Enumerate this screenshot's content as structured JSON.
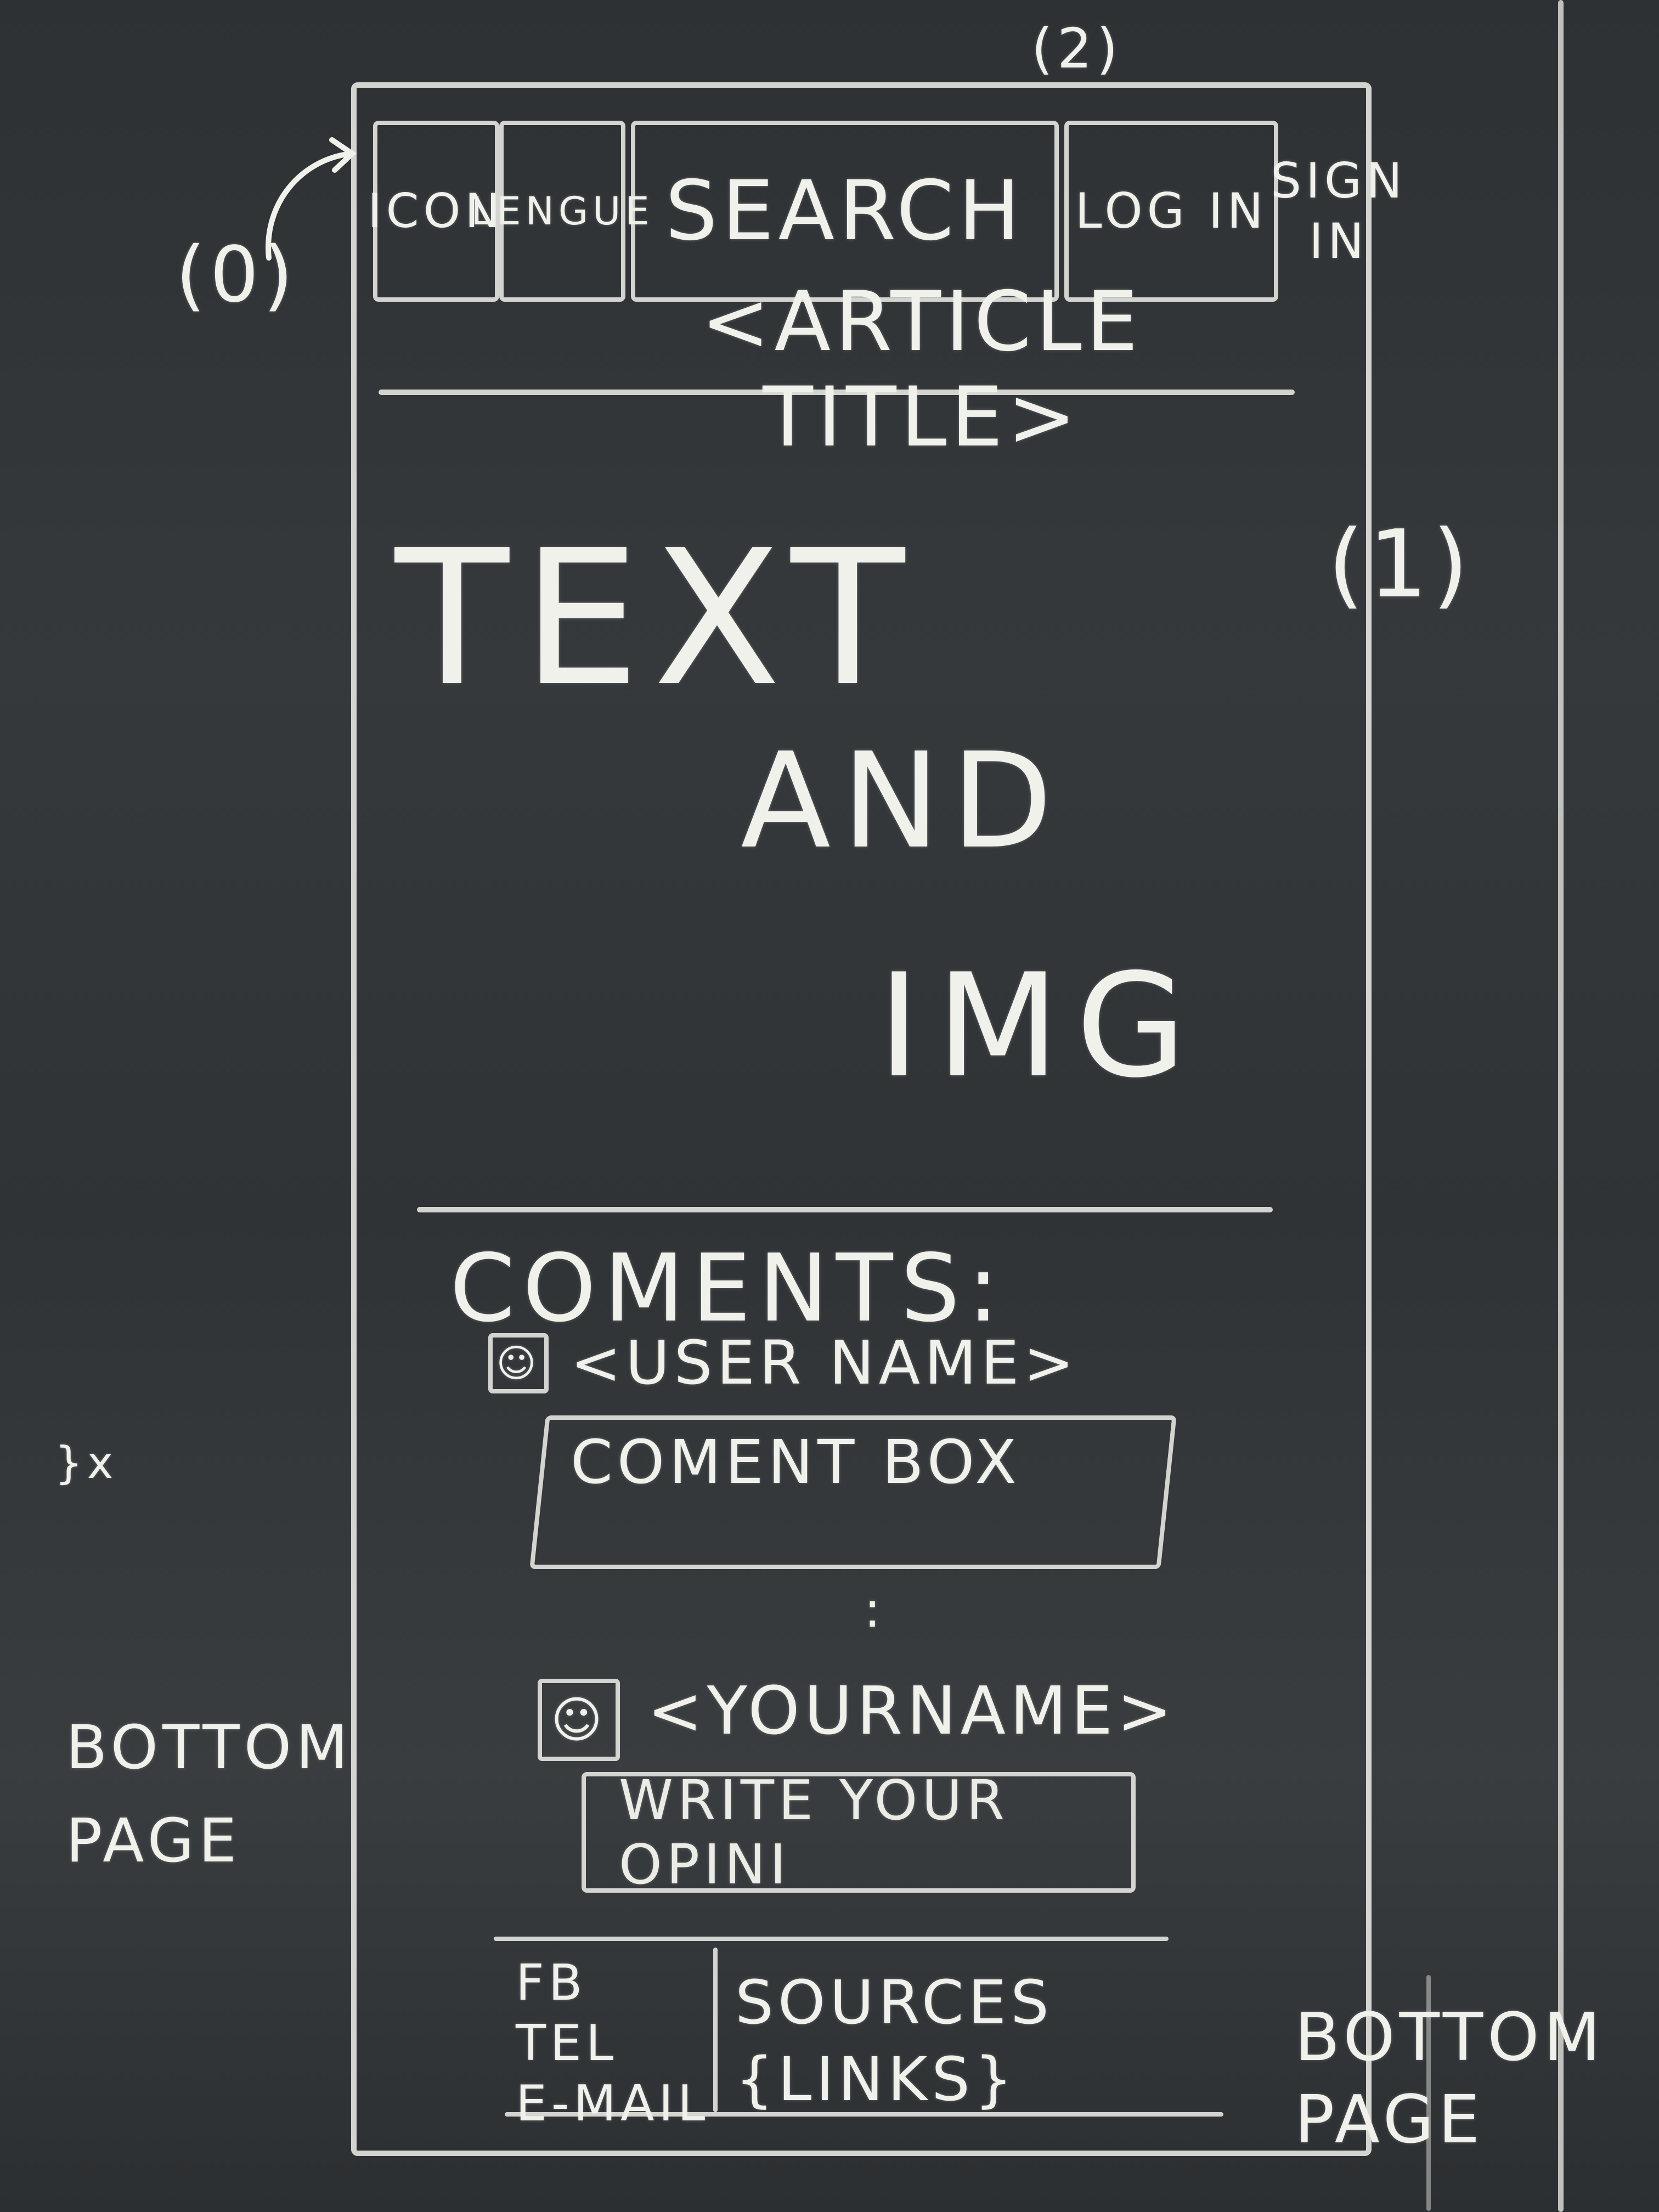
{
  "header": {
    "icon_label": "ICON",
    "language_label": "LENGUE",
    "search_label": "SEARCH",
    "login_label": "LOG IN",
    "signin_label": "SIGN IN"
  },
  "annotations": {
    "label_0": "(0)",
    "label_1": "(1)",
    "label_2": "(2)",
    "left_x": "}x",
    "left_bottom_page": "BOTTOM PAGE",
    "right_bottom_page": "BOTTOM PAGE"
  },
  "article": {
    "title": "<ARTICLE TITLE>",
    "content_text": "TEXT",
    "content_and": "AND",
    "content_img": "IMG"
  },
  "comments": {
    "heading": "COMENTS:",
    "user_name": "<USER NAME>",
    "comment_box": "COMENT BOX",
    "ellipsis": ":",
    "your_name": "<YOURNAME>",
    "write_opinion_placeholder": "WRITE YOUR OPINI"
  },
  "footer": {
    "contact": "FB\nTEL\nE-MAIL",
    "sources": "SOURCES\n{LINKS}"
  }
}
